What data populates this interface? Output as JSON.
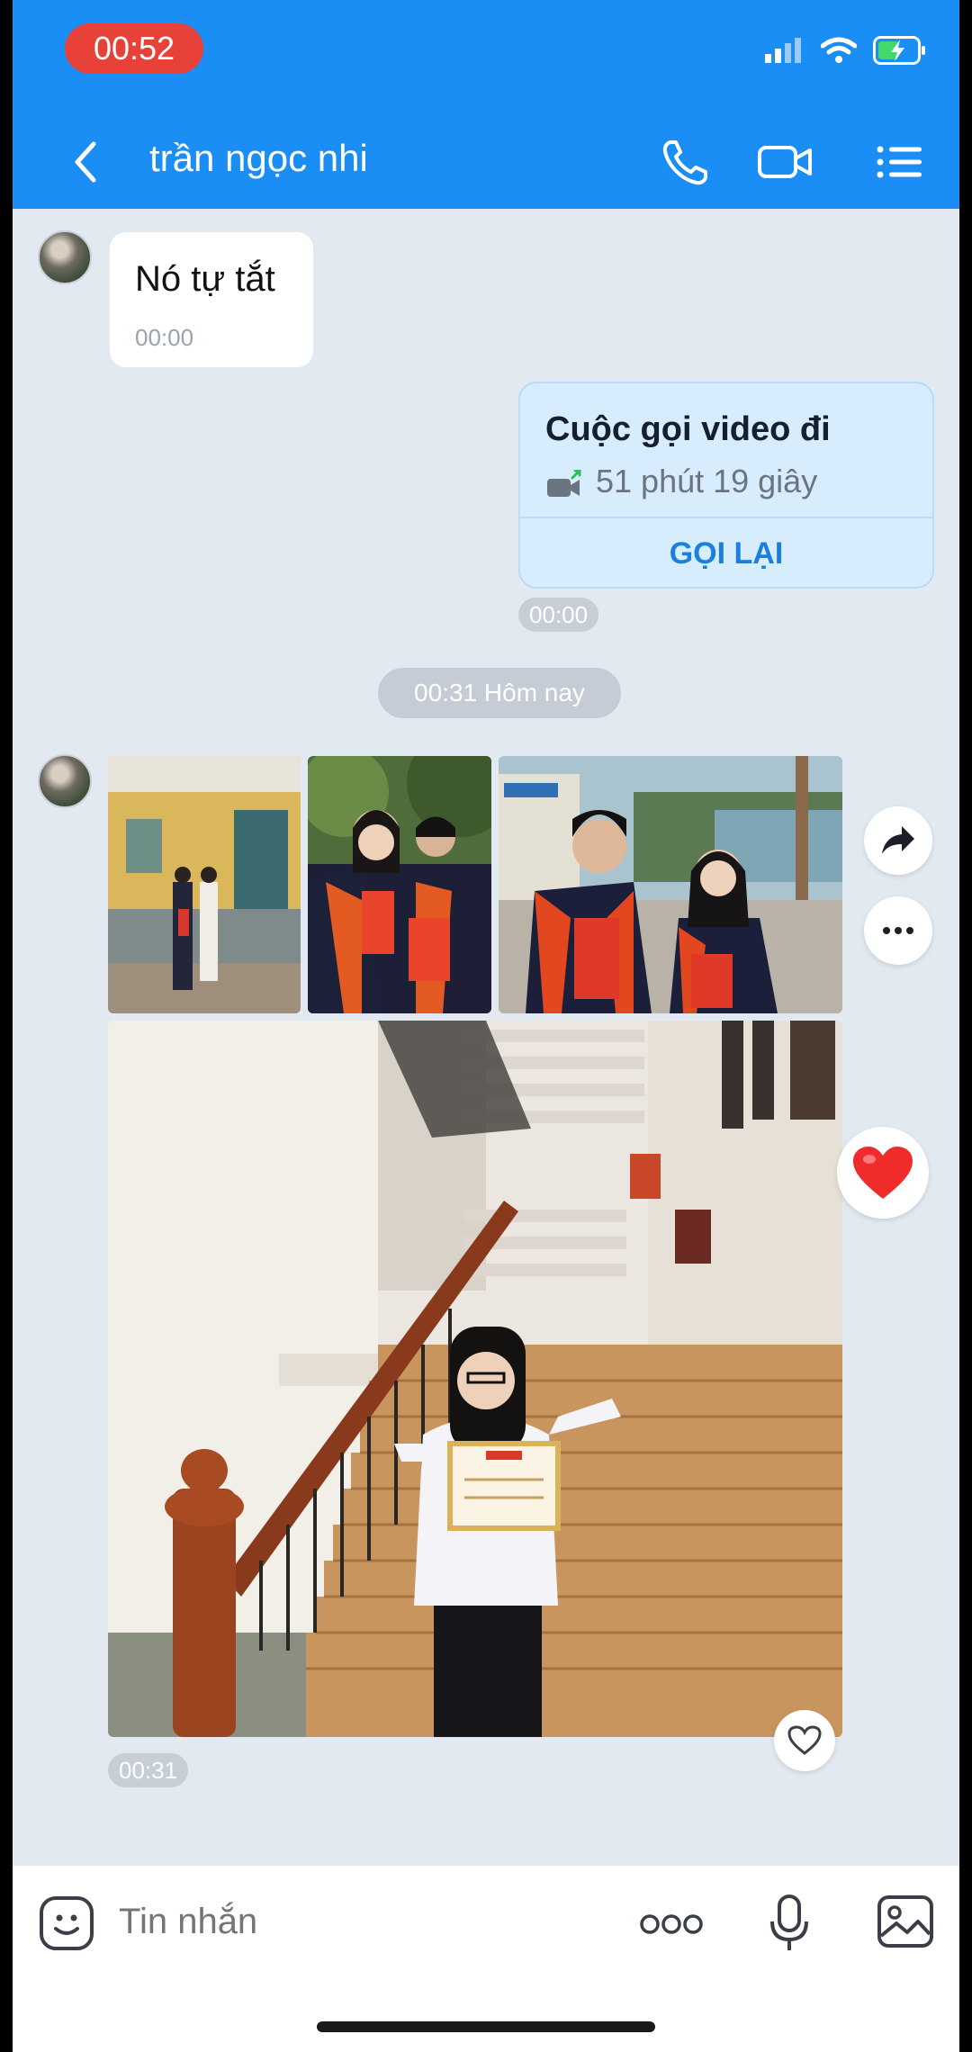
{
  "status_bar": {
    "time": "00:52"
  },
  "header": {
    "title": "trần ngọc nhi"
  },
  "messages": {
    "incoming_text": "Nó tự tắt",
    "incoming_time": "00:00",
    "call": {
      "title": "Cuộc gọi video đi",
      "duration": "51 phút 19 giây",
      "callback_label": "GỌI LẠI",
      "time": "00:00"
    },
    "date_separator": "00:31 Hôm nay",
    "photos_time": "00:31"
  },
  "composer": {
    "placeholder": "Tin nhắn"
  },
  "colors": {
    "header": "#1b8ef5",
    "background": "#e2e9f1",
    "accent": "#1b7fe0",
    "time_pill": "#e8413a",
    "heart": "#ef2b2b"
  }
}
